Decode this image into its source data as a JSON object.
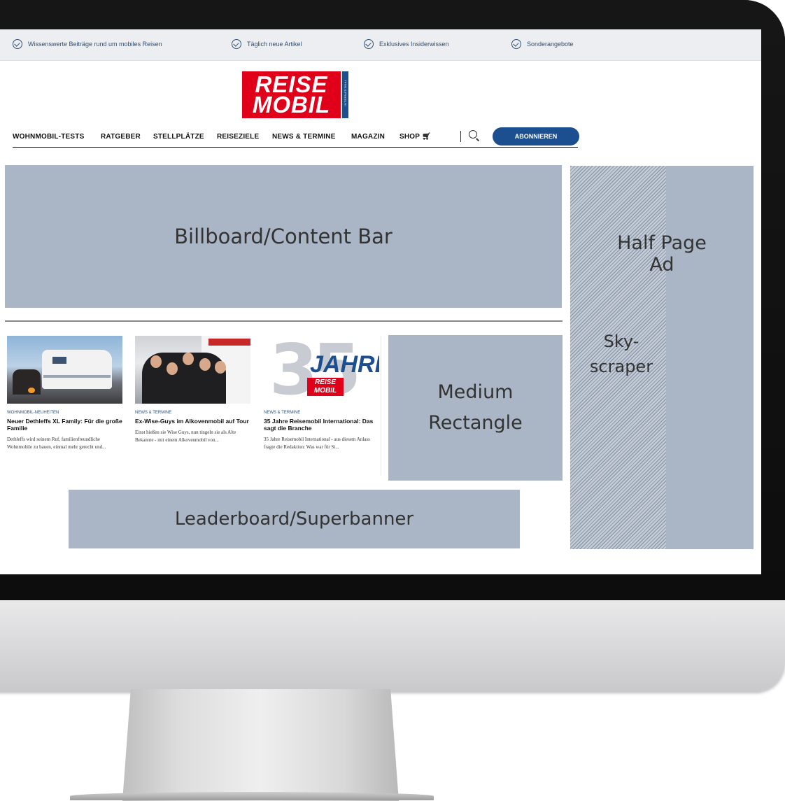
{
  "topbar": {
    "items": [
      "Wissenswerte Beiträge rund um mobiles Reisen",
      "Täglich neue Artikel",
      "Exklusives Insiderwissen",
      "Sonderangebote"
    ]
  },
  "logo": {
    "line1": "REISE",
    "line2": "MOBIL",
    "tag": "INTERNATIONAL"
  },
  "nav": {
    "items": [
      "WOHNMOBIL-TESTS",
      "RATGEBER",
      "STELLPLÄTZE",
      "REISEZIELE",
      "NEWS & TERMINE",
      "MAGAZIN",
      "SHOP"
    ],
    "subscribe": "ABONNIEREN"
  },
  "ads": {
    "billboard": "Billboard/Content Bar",
    "medium_line1": "Medium",
    "medium_line2": "Rectangle",
    "leaderboard": "Leaderboard/Superbanner",
    "half_page": "Half Page Ad",
    "sky_line1": "Sky-",
    "sky_line2": "scraper"
  },
  "cards": [
    {
      "category": "WOHNMOBIL-NEUHEITEN",
      "title": "Neuer Dethleffs XL Family: Für die große Familie",
      "text": "Dethleffs wird seinem Ruf, familienfreundliche Wohnmobile zu bauen, einmal mehr gerecht und..."
    },
    {
      "category": "NEWS & TERMINE",
      "title": "Ex-Wise-Guys im Alkovenmobil auf Tour",
      "text": "Einst hießen sie Wise Guys, nun tingeln sie als Alte Bekannte - mit einem Alkovenmobil von..."
    },
    {
      "category": "NEWS & TERMINE",
      "title": "35 Jahre Reisemobil International: Das sagt die Branche",
      "text": "35 Jahre Reisemobil International - aus diesem Anlass fragte die Redaktion: Was war für Si...",
      "image_number": "35",
      "image_word": "JAHRE",
      "image_logo_1": "REISE",
      "image_logo_2": "MOBIL"
    }
  ],
  "colors": {
    "brand_red": "#e1001a",
    "brand_blue": "#1c4f8f",
    "ad_placeholder": "#aab5c5"
  }
}
